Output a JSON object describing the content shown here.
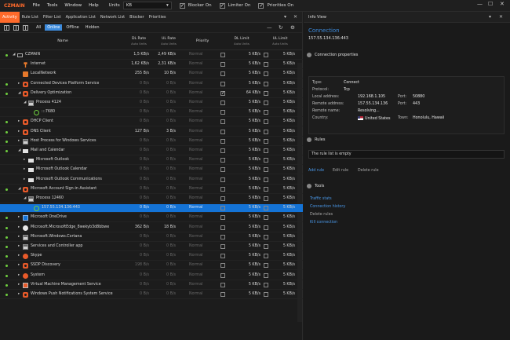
{
  "menubar": {
    "brand": "CZMAIN",
    "items": [
      "File",
      "Tools",
      "Window",
      "Help"
    ],
    "units_label": "Units",
    "units_value": "KB",
    "checks": [
      {
        "label": "Blocker On",
        "checked": true
      },
      {
        "label": "Limiter On",
        "checked": true
      },
      {
        "label": "Priorities On",
        "checked": true
      }
    ]
  },
  "tabs": [
    "Activity",
    "Rule List",
    "Filter List",
    "Application List",
    "Network List",
    "Blocker",
    "Priorities"
  ],
  "filters": [
    "All",
    "Online",
    "Offline",
    "Hidden"
  ],
  "columns": {
    "name": "Name",
    "dl_rate": "DL Rate",
    "dl_rate_sub": "Auto Units",
    "ul_rate": "UL Rate",
    "ul_rate_sub": "Auto Units",
    "priority": "Priority",
    "dl_limit": "DL Limit",
    "dl_limit_sub": "Auto Units",
    "ul_limit": "UL Limit",
    "ul_limit_sub": "Auto Units"
  },
  "rows": [
    {
      "name": "CZMAIN",
      "dl": "1,5 KB/s",
      "ul": "2,49 KB/s",
      "pri": "Normal",
      "dlim": "5 KB/s",
      "ulim": "5 KB/s",
      "indent": 0,
      "icon": "monitor",
      "dot": true,
      "expand": "down",
      "dim": false,
      "checked": false
    },
    {
      "name": "Internet",
      "dl": "1,62 KB/s",
      "ul": "2,31 KB/s",
      "pri": "Normal",
      "dlim": "5 KB/s",
      "ulim": "5 KB/s",
      "indent": 1,
      "icon": "pin",
      "dot": false,
      "expand": "",
      "dim": false,
      "checked": false
    },
    {
      "name": "LocalNetwork",
      "dl": "255 B/s",
      "ul": "10 B/s",
      "pri": "Normal",
      "dlim": "5 KB/s",
      "ulim": "5 KB/s",
      "indent": 1,
      "icon": "net",
      "dot": false,
      "expand": "",
      "dim": false,
      "checked": false
    },
    {
      "name": "Connected Devices Platform Service",
      "dl": "0 B/s",
      "ul": "0 B/s",
      "pri": "Normal",
      "dlim": "5 KB/s",
      "ulim": "5 KB/s",
      "indent": 1,
      "icon": "gear",
      "dot": true,
      "expand": "right",
      "dim": true,
      "checked": false
    },
    {
      "name": "Delivery Optimization",
      "dl": "0 B/s",
      "ul": "0 B/s",
      "pri": "Normal",
      "dlim": "64 KB/s",
      "ulim": "5 KB/s",
      "indent": 1,
      "icon": "gear",
      "dot": true,
      "expand": "down",
      "dim": true,
      "checked": true
    },
    {
      "name": "Process 4124",
      "dl": "0 B/s",
      "ul": "0 B/s",
      "pri": "Normal",
      "dlim": "5 KB/s",
      "ulim": "5 KB/s",
      "indent": 2,
      "icon": "app",
      "dot": false,
      "expand": "down",
      "dim": true,
      "checked": false
    },
    {
      "name": ":::7680",
      "dl": "0 B/s",
      "ul": "0 B/s",
      "pri": "Normal",
      "dlim": "5 KB/s",
      "ulim": "5 KB/s",
      "indent": 3,
      "icon": "conn",
      "dot": false,
      "expand": "",
      "dim": true,
      "checked": false
    },
    {
      "name": "DHCP Client",
      "dl": "0 B/s",
      "ul": "0 B/s",
      "pri": "Normal",
      "dlim": "5 KB/s",
      "ulim": "5 KB/s",
      "indent": 1,
      "icon": "gear",
      "dot": true,
      "expand": "right",
      "dim": true,
      "checked": false
    },
    {
      "name": "DNS Client",
      "dl": "127 B/s",
      "ul": "3 B/s",
      "pri": "Normal",
      "dlim": "5 KB/s",
      "ulim": "5 KB/s",
      "indent": 1,
      "icon": "gear",
      "dot": true,
      "expand": "right",
      "dim": false,
      "checked": false
    },
    {
      "name": "Host Process for Windows Services",
      "dl": "0 B/s",
      "ul": "0 B/s",
      "pri": "Normal",
      "dlim": "5 KB/s",
      "ulim": "5 KB/s",
      "indent": 1,
      "icon": "app",
      "dot": true,
      "expand": "right",
      "dim": true,
      "checked": false
    },
    {
      "name": "Mail and Calendar",
      "dl": "0 B/s",
      "ul": "0 B/s",
      "pri": "Normal",
      "dlim": "5 KB/s",
      "ulim": "5 KB/s",
      "indent": 1,
      "icon": "mail",
      "dot": true,
      "expand": "down",
      "dim": true,
      "checked": false
    },
    {
      "name": "Microsoft Outlook",
      "dl": "0 B/s",
      "ul": "0 B/s",
      "pri": "Normal",
      "dlim": "5 KB/s",
      "ulim": "5 KB/s",
      "indent": 2,
      "icon": "mail",
      "dot": false,
      "expand": "right",
      "dim": true,
      "checked": false
    },
    {
      "name": "Microsoft Outlook Calendar",
      "dl": "0 B/s",
      "ul": "0 B/s",
      "pri": "Normal",
      "dlim": "5 KB/s",
      "ulim": "5 KB/s",
      "indent": 2,
      "icon": "mail",
      "dot": false,
      "expand": "right",
      "dim": true,
      "checked": false
    },
    {
      "name": "Microsoft Outlook Communications",
      "dl": "0 B/s",
      "ul": "0 B/s",
      "pri": "Normal",
      "dlim": "5 KB/s",
      "ulim": "5 KB/s",
      "indent": 2,
      "icon": "mail",
      "dot": false,
      "expand": "right",
      "dim": true,
      "checked": false
    },
    {
      "name": "Microsoft Account Sign-in Assistant",
      "dl": "0 B/s",
      "ul": "0 B/s",
      "pri": "Normal",
      "dlim": "5 KB/s",
      "ulim": "5 KB/s",
      "indent": 1,
      "icon": "gear",
      "dot": true,
      "expand": "down",
      "dim": true,
      "checked": false
    },
    {
      "name": "Process 12460",
      "dl": "0 B/s",
      "ul": "0 B/s",
      "pri": "Normal",
      "dlim": "5 KB/s",
      "ulim": "5 KB/s",
      "indent": 2,
      "icon": "app",
      "dot": false,
      "expand": "down",
      "dim": true,
      "checked": false
    },
    {
      "name": "157.55.134.136:443",
      "dl": "0 B/s",
      "ul": "0 B/s",
      "pri": "Normal",
      "dlim": "5 KB/s",
      "ulim": "5 KB/s",
      "indent": 3,
      "icon": "conn",
      "dot": false,
      "expand": "",
      "dim": true,
      "checked": false,
      "selected": true
    },
    {
      "name": "Microsoft OneDrive",
      "dl": "0 B/s",
      "ul": "0 B/s",
      "pri": "Normal",
      "dlim": "5 KB/s",
      "ulim": "5 KB/s",
      "indent": 1,
      "icon": "wide",
      "dot": true,
      "expand": "right",
      "dim": true,
      "checked": false
    },
    {
      "name": "Microsoft.MicrosoftEdge_8wekyb3d8bbwe",
      "dl": "362 B/s",
      "ul": "18 B/s",
      "pri": "Normal",
      "dlim": "5 KB/s",
      "ulim": "5 KB/s",
      "indent": 1,
      "icon": "edge",
      "dot": true,
      "expand": "right",
      "dim": false,
      "checked": false
    },
    {
      "name": "Microsoft.Windows.Cortana",
      "dl": "0 B/s",
      "ul": "0 B/s",
      "pri": "Normal",
      "dlim": "5 KB/s",
      "ulim": "5 KB/s",
      "indent": 1,
      "icon": "app",
      "dot": true,
      "expand": "right",
      "dim": true,
      "checked": false
    },
    {
      "name": "Services and Controller app",
      "dl": "0 B/s",
      "ul": "0 B/s",
      "pri": "Normal",
      "dlim": "5 KB/s",
      "ulim": "5 KB/s",
      "indent": 1,
      "icon": "app",
      "dot": true,
      "expand": "right",
      "dim": true,
      "checked": false
    },
    {
      "name": "Skype",
      "dl": "0 B/s",
      "ul": "0 B/s",
      "pri": "Normal",
      "dlim": "5 KB/s",
      "ulim": "5 KB/s",
      "indent": 1,
      "icon": "skype",
      "dot": true,
      "expand": "right",
      "dim": true,
      "checked": false
    },
    {
      "name": "SSDP Discovery",
      "dl": "198 B/s",
      "ul": "0 B/s",
      "pri": "Normal",
      "dlim": "5 KB/s",
      "ulim": "5 KB/s",
      "indent": 1,
      "icon": "gear",
      "dot": true,
      "expand": "right",
      "dim": true,
      "checked": false
    },
    {
      "name": "System",
      "dl": "0 B/s",
      "ul": "0 B/s",
      "pri": "Normal",
      "dlim": "5 KB/s",
      "ulim": "5 KB/s",
      "indent": 1,
      "icon": "cdot",
      "dot": true,
      "expand": "right",
      "dim": true,
      "checked": false
    },
    {
      "name": "Virtual Machine Management Service",
      "dl": "0 B/s",
      "ul": "0 B/s",
      "pri": "Normal",
      "dlim": "5 KB/s",
      "ulim": "5 KB/s",
      "indent": 1,
      "icon": "box",
      "dot": true,
      "expand": "right",
      "dim": true,
      "checked": false
    },
    {
      "name": "Windows Push Notifications System Service",
      "dl": "0 B/s",
      "ul": "0 B/s",
      "pri": "Normal",
      "dlim": "5 KB/s",
      "ulim": "5 KB/s",
      "indent": 1,
      "icon": "gear",
      "dot": true,
      "expand": "right",
      "dim": true,
      "checked": false
    }
  ],
  "info": {
    "panel_title": "Info View",
    "title": "Connection",
    "subtitle": "157.55.134.136:443",
    "props_heading": "Connection properties",
    "type_label": "Type:",
    "type_value": "Connect",
    "protocol_label": "Protocol:",
    "protocol_value": "Tcp",
    "local_label": "Local address:",
    "local_value": "192.168.1.105",
    "local_port_label": "Port:",
    "local_port_value": "50880",
    "remote_label": "Remote address:",
    "remote_value": "157.55.134.136",
    "remote_port_label": "Port:",
    "remote_port_value": "443",
    "remote_name_label": "Remote name:",
    "remote_name_value": "Resolving...",
    "country_label": "Country:",
    "country_value": "United States",
    "town_label": "Town:",
    "town_value": "Honolulu, Hawaii",
    "rules_heading": "Rules",
    "rules_text": "The rule list is empty",
    "rule_links": [
      "Add rule",
      "Edit rule",
      "Delete rule"
    ],
    "tools_heading": "Tools",
    "tool_links": [
      "Traffic stats",
      "Connection history",
      "Delete rules",
      "Kill connection"
    ]
  }
}
